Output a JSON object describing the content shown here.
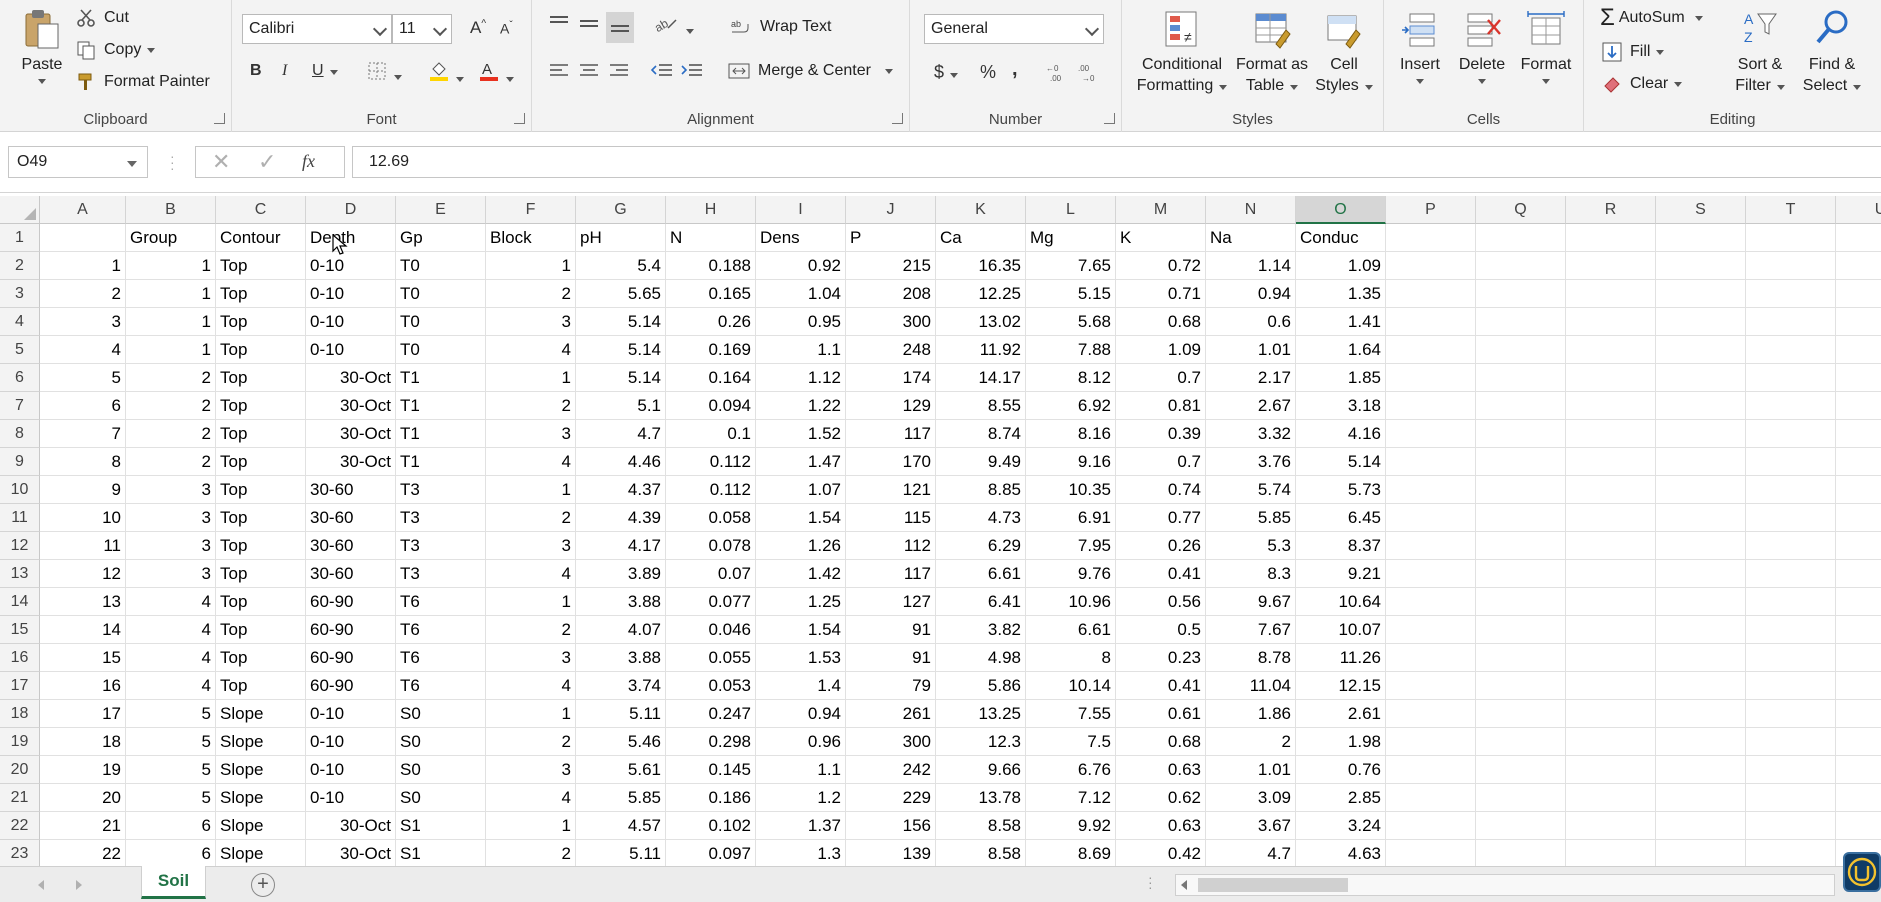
{
  "ribbon": {
    "clipboard": {
      "paste": "Paste",
      "cut": "Cut",
      "copy": "Copy",
      "format_painter": "Format Painter",
      "label": "Clipboard"
    },
    "font": {
      "name": "Calibri",
      "size": "11",
      "bold": "B",
      "italic": "I",
      "underline": "U",
      "grow": "A",
      "shrink": "A",
      "label": "Font"
    },
    "alignment": {
      "wrap_text": "Wrap Text",
      "merge_center": "Merge & Center",
      "label": "Alignment"
    },
    "number": {
      "format": "General",
      "currency": "$",
      "percent": "%",
      "comma": ",",
      "label": "Number"
    },
    "styles": {
      "conditional_1": "Conditional",
      "conditional_2": "Formatting",
      "format_table_1": "Format as",
      "format_table_2": "Table",
      "cell_styles_1": "Cell",
      "cell_styles_2": "Styles",
      "label": "Styles"
    },
    "cells": {
      "insert": "Insert",
      "delete": "Delete",
      "format": "Format",
      "label": "Cells"
    },
    "editing": {
      "autosum": "AutoSum",
      "fill": "Fill",
      "clear": "Clear",
      "sort_1": "Sort &",
      "sort_2": "Filter",
      "find_1": "Find &",
      "find_2": "Select",
      "label": "Editing"
    }
  },
  "formula_bar": {
    "name_box": "O49",
    "fx": "fx",
    "value": "12.69"
  },
  "columns": [
    "A",
    "B",
    "C",
    "D",
    "E",
    "F",
    "G",
    "H",
    "I",
    "J",
    "K",
    "L",
    "M",
    "N",
    "O",
    "P",
    "Q",
    "R",
    "S",
    "T",
    "U"
  ],
  "selected_column": "O",
  "rows": [
    [
      "",
      "Group",
      "Contour",
      "Depth",
      "Gp",
      "Block",
      "pH",
      "N",
      "Dens",
      "P",
      "Ca",
      "Mg",
      "K",
      "Na",
      "Conduc"
    ],
    [
      "1",
      "1",
      "Top",
      "0-10",
      "T0",
      "1",
      "5.4",
      "0.188",
      "0.92",
      "215",
      "16.35",
      "7.65",
      "0.72",
      "1.14",
      "1.09"
    ],
    [
      "2",
      "1",
      "Top",
      "0-10",
      "T0",
      "2",
      "5.65",
      "0.165",
      "1.04",
      "208",
      "12.25",
      "5.15",
      "0.71",
      "0.94",
      "1.35"
    ],
    [
      "3",
      "1",
      "Top",
      "0-10",
      "T0",
      "3",
      "5.14",
      "0.26",
      "0.95",
      "300",
      "13.02",
      "5.68",
      "0.68",
      "0.6",
      "1.41"
    ],
    [
      "4",
      "1",
      "Top",
      "0-10",
      "T0",
      "4",
      "5.14",
      "0.169",
      "1.1",
      "248",
      "11.92",
      "7.88",
      "1.09",
      "1.01",
      "1.64"
    ],
    [
      "5",
      "2",
      "Top",
      "30-Oct",
      "T1",
      "1",
      "5.14",
      "0.164",
      "1.12",
      "174",
      "14.17",
      "8.12",
      "0.7",
      "2.17",
      "1.85"
    ],
    [
      "6",
      "2",
      "Top",
      "30-Oct",
      "T1",
      "2",
      "5.1",
      "0.094",
      "1.22",
      "129",
      "8.55",
      "6.92",
      "0.81",
      "2.67",
      "3.18"
    ],
    [
      "7",
      "2",
      "Top",
      "30-Oct",
      "T1",
      "3",
      "4.7",
      "0.1",
      "1.52",
      "117",
      "8.74",
      "8.16",
      "0.39",
      "3.32",
      "4.16"
    ],
    [
      "8",
      "2",
      "Top",
      "30-Oct",
      "T1",
      "4",
      "4.46",
      "0.112",
      "1.47",
      "170",
      "9.49",
      "9.16",
      "0.7",
      "3.76",
      "5.14"
    ],
    [
      "9",
      "3",
      "Top",
      "30-60",
      "T3",
      "1",
      "4.37",
      "0.112",
      "1.07",
      "121",
      "8.85",
      "10.35",
      "0.74",
      "5.74",
      "5.73"
    ],
    [
      "10",
      "3",
      "Top",
      "30-60",
      "T3",
      "2",
      "4.39",
      "0.058",
      "1.54",
      "115",
      "4.73",
      "6.91",
      "0.77",
      "5.85",
      "6.45"
    ],
    [
      "11",
      "3",
      "Top",
      "30-60",
      "T3",
      "3",
      "4.17",
      "0.078",
      "1.26",
      "112",
      "6.29",
      "7.95",
      "0.26",
      "5.3",
      "8.37"
    ],
    [
      "12",
      "3",
      "Top",
      "30-60",
      "T3",
      "4",
      "3.89",
      "0.07",
      "1.42",
      "117",
      "6.61",
      "9.76",
      "0.41",
      "8.3",
      "9.21"
    ],
    [
      "13",
      "4",
      "Top",
      "60-90",
      "T6",
      "1",
      "3.88",
      "0.077",
      "1.25",
      "127",
      "6.41",
      "10.96",
      "0.56",
      "9.67",
      "10.64"
    ],
    [
      "14",
      "4",
      "Top",
      "60-90",
      "T6",
      "2",
      "4.07",
      "0.046",
      "1.54",
      "91",
      "3.82",
      "6.61",
      "0.5",
      "7.67",
      "10.07"
    ],
    [
      "15",
      "4",
      "Top",
      "60-90",
      "T6",
      "3",
      "3.88",
      "0.055",
      "1.53",
      "91",
      "4.98",
      "8",
      "0.23",
      "8.78",
      "11.26"
    ],
    [
      "16",
      "4",
      "Top",
      "60-90",
      "T6",
      "4",
      "3.74",
      "0.053",
      "1.4",
      "79",
      "5.86",
      "10.14",
      "0.41",
      "11.04",
      "12.15"
    ],
    [
      "17",
      "5",
      "Slope",
      "0-10",
      "S0",
      "1",
      "5.11",
      "0.247",
      "0.94",
      "261",
      "13.25",
      "7.55",
      "0.61",
      "1.86",
      "2.61"
    ],
    [
      "18",
      "5",
      "Slope",
      "0-10",
      "S0",
      "2",
      "5.46",
      "0.298",
      "0.96",
      "300",
      "12.3",
      "7.5",
      "0.68",
      "2",
      "1.98"
    ],
    [
      "19",
      "5",
      "Slope",
      "0-10",
      "S0",
      "3",
      "5.61",
      "0.145",
      "1.1",
      "242",
      "9.66",
      "6.76",
      "0.63",
      "1.01",
      "0.76"
    ],
    [
      "20",
      "5",
      "Slope",
      "0-10",
      "S0",
      "4",
      "5.85",
      "0.186",
      "1.2",
      "229",
      "13.78",
      "7.12",
      "0.62",
      "3.09",
      "2.85"
    ],
    [
      "21",
      "6",
      "Slope",
      "30-Oct",
      "S1",
      "1",
      "4.57",
      "0.102",
      "1.37",
      "156",
      "8.58",
      "9.92",
      "0.63",
      "3.67",
      "3.24"
    ],
    [
      "22",
      "6",
      "Slope",
      "30-Oct",
      "S1",
      "2",
      "5.11",
      "0.097",
      "1.3",
      "139",
      "8.58",
      "8.69",
      "0.42",
      "4.7",
      "4.63"
    ]
  ],
  "sheet_tabs": {
    "active": "Soil",
    "add": "+"
  },
  "colors": {
    "accent": "#217346",
    "font_color": "#e8311f",
    "highlight": "#ffd500"
  }
}
